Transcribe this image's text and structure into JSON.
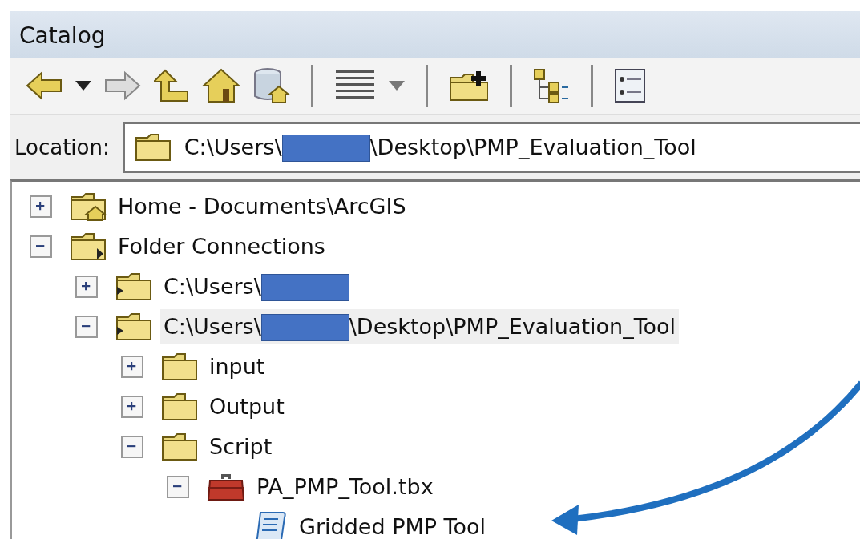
{
  "window": {
    "title": "Catalog"
  },
  "location": {
    "label": "Location:",
    "path_before": "C:\\Users\\",
    "redacted": true,
    "path_after": "\\Desktop\\PMP_Evaluation_Tool"
  },
  "tree": [
    {
      "kind": "home-folder",
      "label_before": "Home - Documents\\ArcGIS",
      "redacted": false,
      "expanded": false,
      "selected": false
    },
    {
      "kind": "connections",
      "label_before": "Folder Connections",
      "redacted": false,
      "expanded": true,
      "selected": false,
      "children": [
        {
          "kind": "connected-folder",
          "label_before": "C:\\Users\\",
          "redacted": true,
          "expanded": false,
          "selected": false
        },
        {
          "kind": "connected-folder",
          "label_before": "C:\\Users\\",
          "redacted": true,
          "label_after": "\\Desktop\\PMP_Evaluation_Tool",
          "expanded": true,
          "selected": true,
          "children": [
            {
              "kind": "folder",
              "label_before": "input",
              "redacted": false,
              "expanded": false,
              "selected": false
            },
            {
              "kind": "folder",
              "label_before": "Output",
              "redacted": false,
              "expanded": false,
              "selected": false
            },
            {
              "kind": "folder",
              "label_before": "Script",
              "redacted": false,
              "expanded": true,
              "selected": false,
              "children": [
                {
                  "kind": "toolbox",
                  "label_before": "PA_PMP_Tool.tbx",
                  "redacted": false,
                  "expanded": true,
                  "selected": false,
                  "children": [
                    {
                      "kind": "script",
                      "label_before": "Gridded PMP Tool",
                      "redacted": false,
                      "selected": false
                    }
                  ]
                }
              ]
            }
          ]
        }
      ]
    }
  ]
}
